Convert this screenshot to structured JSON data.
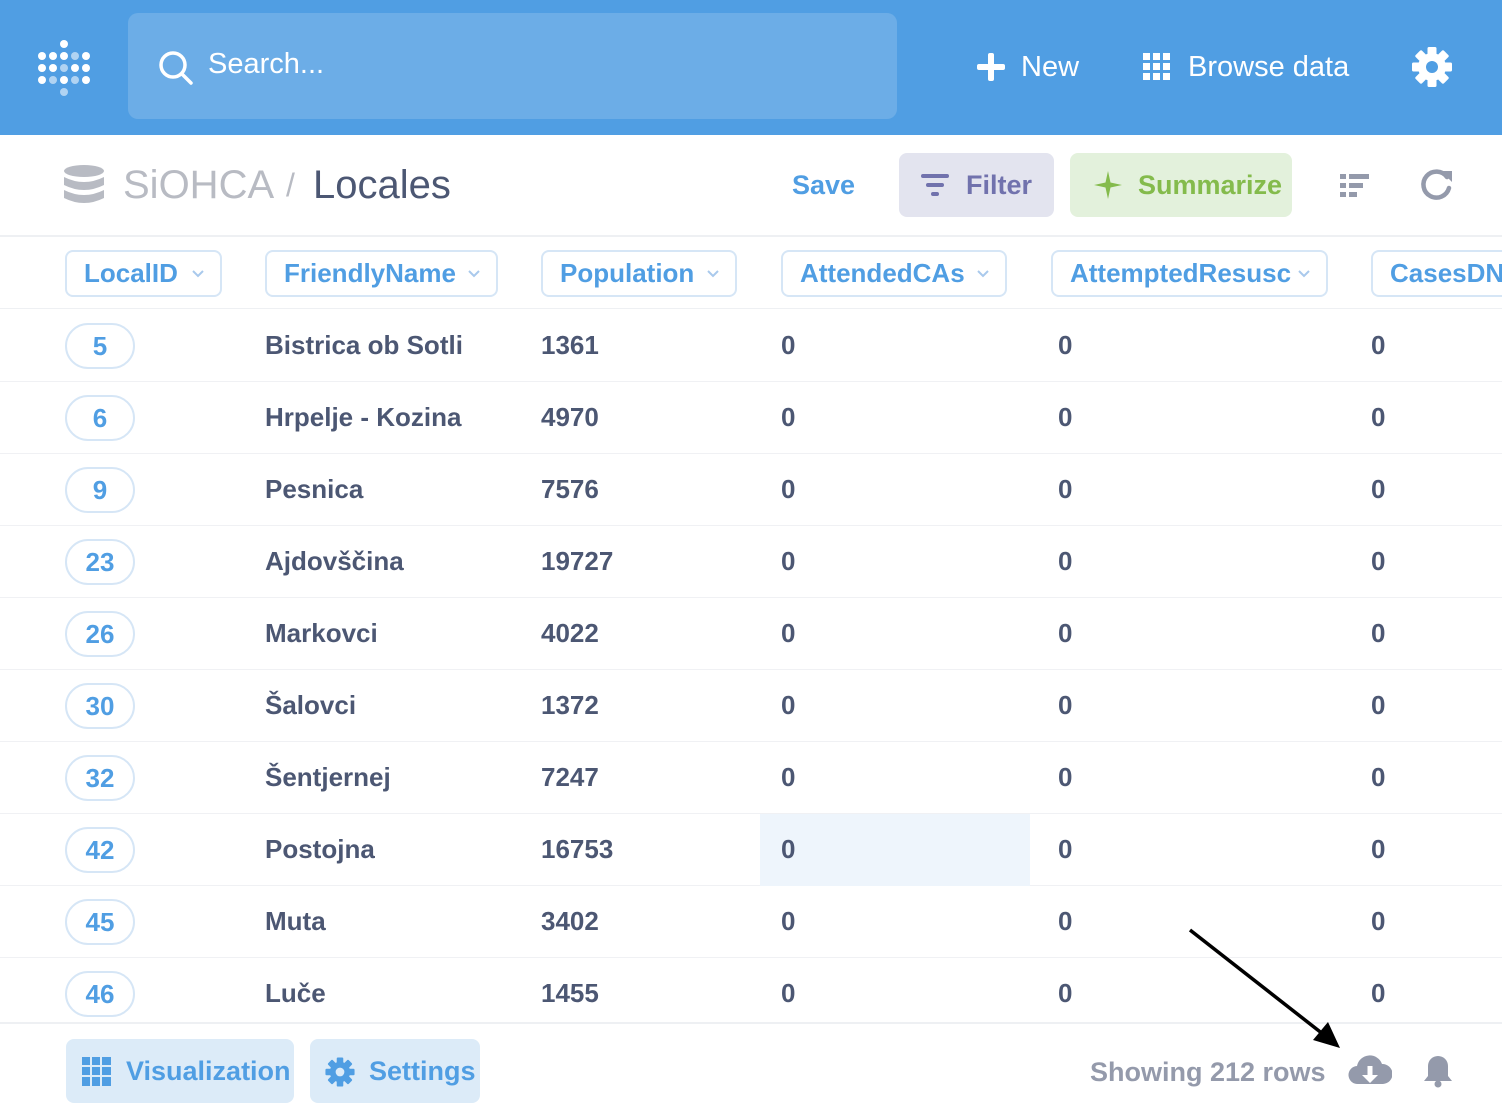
{
  "topbar": {
    "search_placeholder": "Search...",
    "new_label": "New",
    "browse_label": "Browse data",
    "icons": [
      "metabase-logo-icon",
      "search-icon",
      "plus-icon",
      "grid-icon",
      "gear-icon"
    ]
  },
  "header": {
    "database": "SiOHCA",
    "separator": "/",
    "table": "Locales",
    "save_label": "Save",
    "filter_label": "Filter",
    "summarize_label": "Summarize"
  },
  "table": {
    "columns": [
      "LocalID",
      "FriendlyName",
      "Population",
      "AttendedCAs",
      "AttemptedResusc",
      "CasesDNR"
    ],
    "rows": [
      [
        "5",
        "Bistrica ob Sotli",
        "1361",
        "0",
        "0",
        "0"
      ],
      [
        "6",
        "Hrpelje - Kozina",
        "4970",
        "0",
        "0",
        "0"
      ],
      [
        "9",
        "Pesnica",
        "7576",
        "0",
        "0",
        "0"
      ],
      [
        "23",
        "Ajdovščina",
        "19727",
        "0",
        "0",
        "0"
      ],
      [
        "26",
        "Markovci",
        "4022",
        "0",
        "0",
        "0"
      ],
      [
        "30",
        "Šalovci",
        "1372",
        "0",
        "0",
        "0"
      ],
      [
        "32",
        "Šentjernej",
        "7247",
        "0",
        "0",
        "0"
      ],
      [
        "42",
        "Postojna",
        "16753",
        "0",
        "0",
        "0"
      ],
      [
        "45",
        "Muta",
        "3402",
        "0",
        "0",
        "0"
      ],
      [
        "46",
        "Luče",
        "1455",
        "0",
        "0",
        "0"
      ]
    ]
  },
  "footer": {
    "visualization_label": "Visualization",
    "settings_label": "Settings",
    "row_count": "Showing 212 rows"
  },
  "colors": {
    "brand": "#509ee3",
    "filter": "#7172ad",
    "summarize": "#84bb4c",
    "text": "#4c5773"
  }
}
